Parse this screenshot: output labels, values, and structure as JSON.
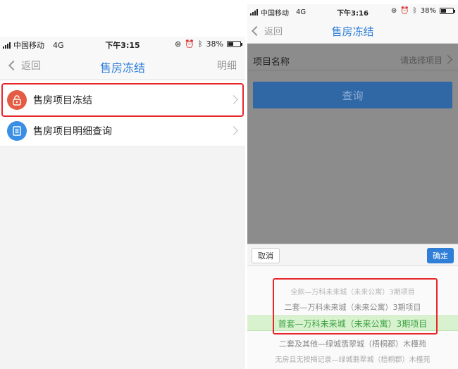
{
  "left": {
    "status": {
      "carrier": "中国移动",
      "network": "4G",
      "time": "下午3:15",
      "battery": "38%"
    },
    "nav": {
      "back": "返回",
      "title": "售房冻结",
      "detail": "明细"
    },
    "items": [
      {
        "label": "售房项目冻结",
        "icon": "lock-icon"
      },
      {
        "label": "售房项目明细查询",
        "icon": "document-icon"
      }
    ]
  },
  "right": {
    "status": {
      "carrier": "中国移动",
      "network": "4G",
      "time": "下午3:16",
      "battery": "38%"
    },
    "nav": {
      "back": "返回",
      "title": "售房冻结"
    },
    "field": {
      "label": "项目名称",
      "placeholder": "请选择项目"
    },
    "query_button": "查询",
    "picker": {
      "cancel": "取消",
      "confirm": "确定",
      "options": [
        "全款—万科未来城（未来公寓）3期项目",
        "二套—万科未来城（未来公寓）3期项目",
        "首套—万科未来城（未来公寓）3期项目",
        "二套及其他—绿城翡翠城（梧桐郡）木槿苑",
        "无房且无按揭记录—绿城翡翠城（梧桐郡）木槿苑"
      ],
      "selected_index": 2
    }
  },
  "colors": {
    "accent": "#2f7fd8",
    "highlight": "#e8262a",
    "selected_text": "#3aa140"
  }
}
